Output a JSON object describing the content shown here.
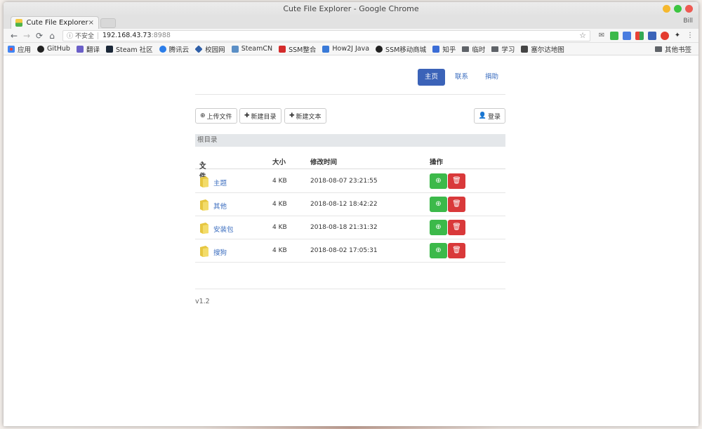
{
  "window": {
    "title": "Cute File Explorer - Google Chrome"
  },
  "tab": {
    "title": "Cute File Explorer",
    "close": "×"
  },
  "profile": "Bill",
  "address": {
    "security": "不安全",
    "host": "192.168.43.73",
    "port": ":8988"
  },
  "bookmarks": [
    {
      "label": "应用",
      "color": "#5a8ad8"
    },
    {
      "label": "GitHub",
      "color": "#222222"
    },
    {
      "label": "翻译",
      "color": "#6b5fc8"
    },
    {
      "label": "Steam 社区",
      "color": "#1b2838"
    },
    {
      "label": "腾讯云",
      "color": "#2b7de9"
    },
    {
      "label": "校园网",
      "color": "#2f5fa8"
    },
    {
      "label": "SteamCN",
      "color": "#5b8fc6"
    },
    {
      "label": "SSM整合",
      "color": "#d42b2b"
    },
    {
      "label": "How2J Java",
      "color": "#3a7ad8"
    },
    {
      "label": "SSM移动商城",
      "color": "#222222"
    },
    {
      "label": "知乎",
      "color": "#3b6dd6"
    },
    {
      "label": "临时",
      "color": "#5f6368"
    },
    {
      "label": "学习",
      "color": "#5f6368"
    },
    {
      "label": "塞尔达地图",
      "color": "#444444"
    }
  ],
  "other_bookmarks": "其他书签",
  "nav": {
    "home": "主页",
    "contact": "联系",
    "donate": "捐助"
  },
  "actions": {
    "upload": "上传文件",
    "new_dir": "新建目录",
    "new_text": "新建文本",
    "login": "登录"
  },
  "breadcrumb": "根目录",
  "table": {
    "headers": {
      "file": "文件",
      "size": "大小",
      "mtime": "修改时间",
      "ops": "操作"
    },
    "rows": [
      {
        "name": "主题",
        "size": "4 KB",
        "mtime": "2018-08-07 23:21:55"
      },
      {
        "name": "其他",
        "size": "4 KB",
        "mtime": "2018-08-12 18:42:22"
      },
      {
        "name": "安装包",
        "size": "4 KB",
        "mtime": "2018-08-18 21:31:32"
      },
      {
        "name": "搜狗",
        "size": "4 KB",
        "mtime": "2018-08-02 17:05:31"
      }
    ]
  },
  "version": "v1.2",
  "colors": {
    "primary": "#3b63b8",
    "success": "#3cb94a",
    "danger": "#d9393a",
    "link": "#3b6dbf"
  }
}
